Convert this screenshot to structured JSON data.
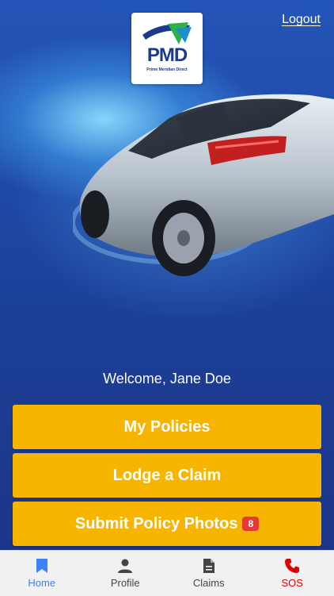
{
  "header": {
    "logout_label": "Logout",
    "logo_text": "PMD",
    "logo_subtitle": "Prime Meridian Direct"
  },
  "main": {
    "welcome_text": "Welcome, Jane Doe",
    "buttons": [
      {
        "label": "My Policies"
      },
      {
        "label": "Lodge a Claim"
      },
      {
        "label": "Submit Policy Photos",
        "badge": "8"
      }
    ]
  },
  "tabbar": {
    "tabs": [
      {
        "label": "Home",
        "icon": "bookmark-icon",
        "active": true
      },
      {
        "label": "Profile",
        "icon": "person-icon"
      },
      {
        "label": "Claims",
        "icon": "document-icon"
      },
      {
        "label": "SOS",
        "icon": "phone-icon"
      }
    ]
  },
  "colors": {
    "button": "#f7b500",
    "badge": "#e53935",
    "active_tab": "#3b82f6",
    "sos": "#e00000",
    "background": "#1e3c8c"
  }
}
